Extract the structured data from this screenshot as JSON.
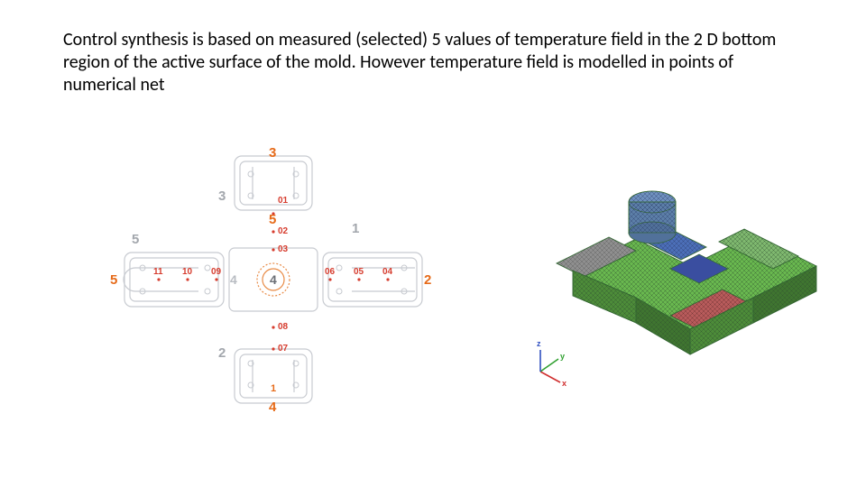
{
  "paragraph": "Control synthesis is based on measured (selected) 5 values of temperature field in the 2 D bottom region of the active surface of the mold. However temperature field is modelled in points of numerical net",
  "left_diagram": {
    "branch_numbers_gray": {
      "top": "3",
      "left": "5",
      "right": "1",
      "bottom": "2"
    },
    "branch_numbers_orange": {
      "top": "3",
      "left": "5",
      "right": "2",
      "bottom": "4",
      "mid": "5"
    },
    "center_number": "4",
    "horizontal_points_left": [
      "11",
      "10",
      "09"
    ],
    "horizontal_points_right": [
      "06",
      "05",
      "04"
    ],
    "vertical_points": {
      "above": [
        "01",
        "02",
        "03"
      ],
      "below": [
        "08",
        "07"
      ]
    },
    "left_end_label": "1"
  },
  "right_diagram": {
    "axes": {
      "x": "x",
      "y": "y",
      "z": "z"
    },
    "colors": {
      "top_arm": "#4c6fb8",
      "bottom_arm": "#b85b5b",
      "left_arm": "#8f8f8f",
      "right_arm": "#7fb86f",
      "base": "#69b84f",
      "cylinder": "#5c7fa8",
      "center_patch": "#3a4ea0"
    }
  }
}
